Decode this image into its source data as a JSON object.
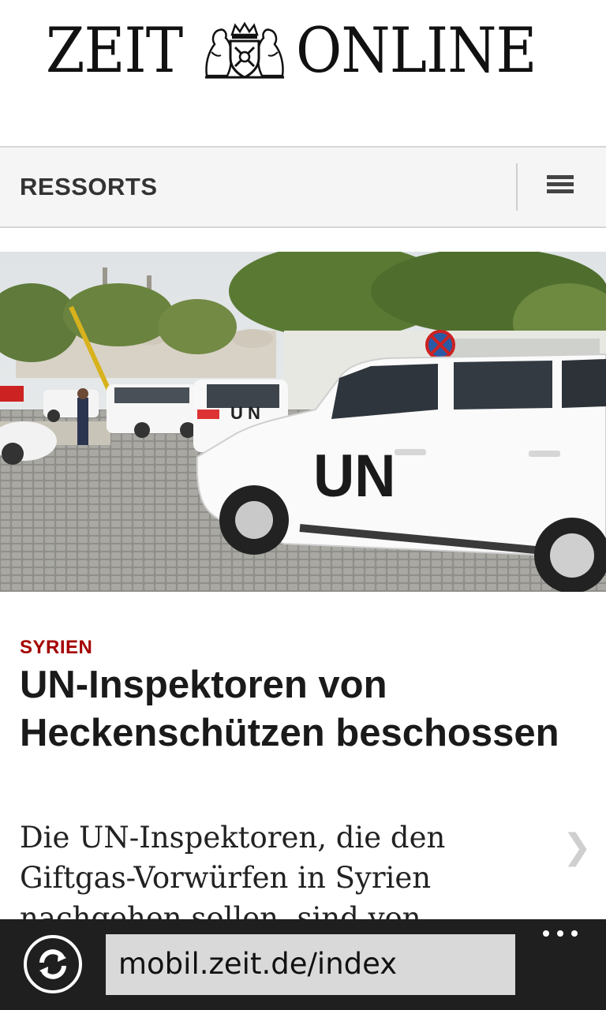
{
  "header": {
    "logo_left": "ZEIT",
    "logo_right": "ONLINE"
  },
  "nav": {
    "ressorts_label": "RESSORTS",
    "menu_icon": "hamburger-menu-icon"
  },
  "article": {
    "image_alt": "White UN vehicles parked on a cobblestone street",
    "kicker": "SYRIEN",
    "headline": "UN-Inspektoren von Heckenschützen beschossen",
    "teaser": "Die UN-Inspektoren, die den Giftgas-Vorwürfen in Syrien nachgehen sollen, sind von",
    "chevron_icon": "chevron-right-icon",
    "kicker_color": "#a40000"
  },
  "browser": {
    "url": "mobil.zeit.de/index",
    "refresh_icon": "refresh-icon",
    "more_icon": "more-dots-icon"
  }
}
